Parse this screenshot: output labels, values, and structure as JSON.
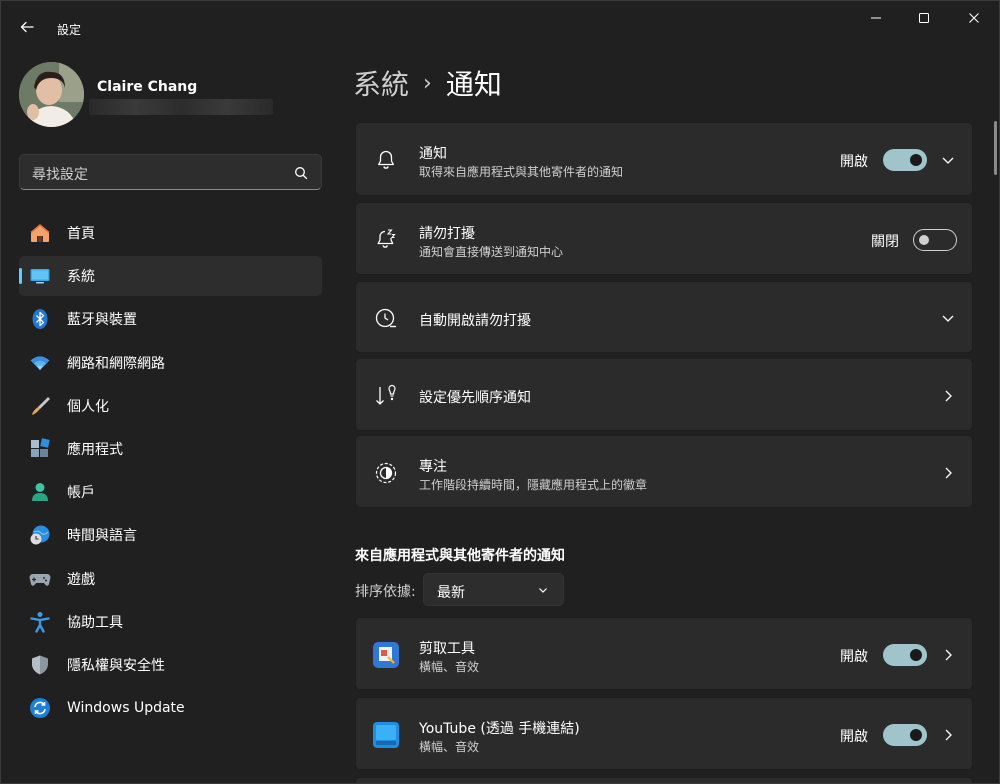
{
  "window": {
    "title": "設定"
  },
  "profile": {
    "name": "Claire Chang"
  },
  "search": {
    "placeholder": "尋找設定"
  },
  "sidebar": {
    "items": [
      {
        "label": "首頁",
        "icon": "home-icon"
      },
      {
        "label": "系統",
        "icon": "system-icon",
        "active": true
      },
      {
        "label": "藍牙與裝置",
        "icon": "bluetooth-icon"
      },
      {
        "label": "網路和網際網路",
        "icon": "wifi-icon"
      },
      {
        "label": "個人化",
        "icon": "brush-icon"
      },
      {
        "label": "應用程式",
        "icon": "apps-icon"
      },
      {
        "label": "帳戶",
        "icon": "account-icon"
      },
      {
        "label": "時間與語言",
        "icon": "globe-clock-icon"
      },
      {
        "label": "遊戲",
        "icon": "gamepad-icon"
      },
      {
        "label": "協助工具",
        "icon": "accessibility-icon"
      },
      {
        "label": "隱私權與安全性",
        "icon": "shield-icon"
      },
      {
        "label": "Windows Update",
        "icon": "update-icon"
      }
    ]
  },
  "breadcrumb": {
    "parent": "系統",
    "separator": "›",
    "current": "通知"
  },
  "cards": {
    "notifications": {
      "title": "通知",
      "subtitle": "取得來自應用程式與其他寄件者的通知",
      "state": "開啟",
      "on": true
    },
    "dnd": {
      "title": "請勿打擾",
      "subtitle": "通知會直接傳送到通知中心",
      "state": "關閉",
      "on": false
    },
    "auto_dnd": {
      "title": "自動開啟請勿打擾"
    },
    "priority": {
      "title": "設定優先順序通知"
    },
    "focus": {
      "title": "專注",
      "subtitle": "工作階段持續時間，隱藏應用程式上的徽章"
    }
  },
  "apps_section": {
    "header": "來自應用程式與其他寄件者的通知",
    "sort_label": "排序依據:",
    "sort_value": "最新",
    "apps": [
      {
        "name": "剪取工具",
        "subtitle": "橫幅、音效",
        "state": "開啟",
        "on": true,
        "color": "#2f78d6"
      },
      {
        "name": "YouTube (透過 手機連結)",
        "subtitle": "橫幅、音效",
        "state": "開啟",
        "on": true,
        "color": "#1f8ee0"
      }
    ]
  },
  "colors": {
    "accent": "#60cdff",
    "toggle_on": "#9fc4cc",
    "background": "#202020",
    "card": "#2b2b2b"
  }
}
